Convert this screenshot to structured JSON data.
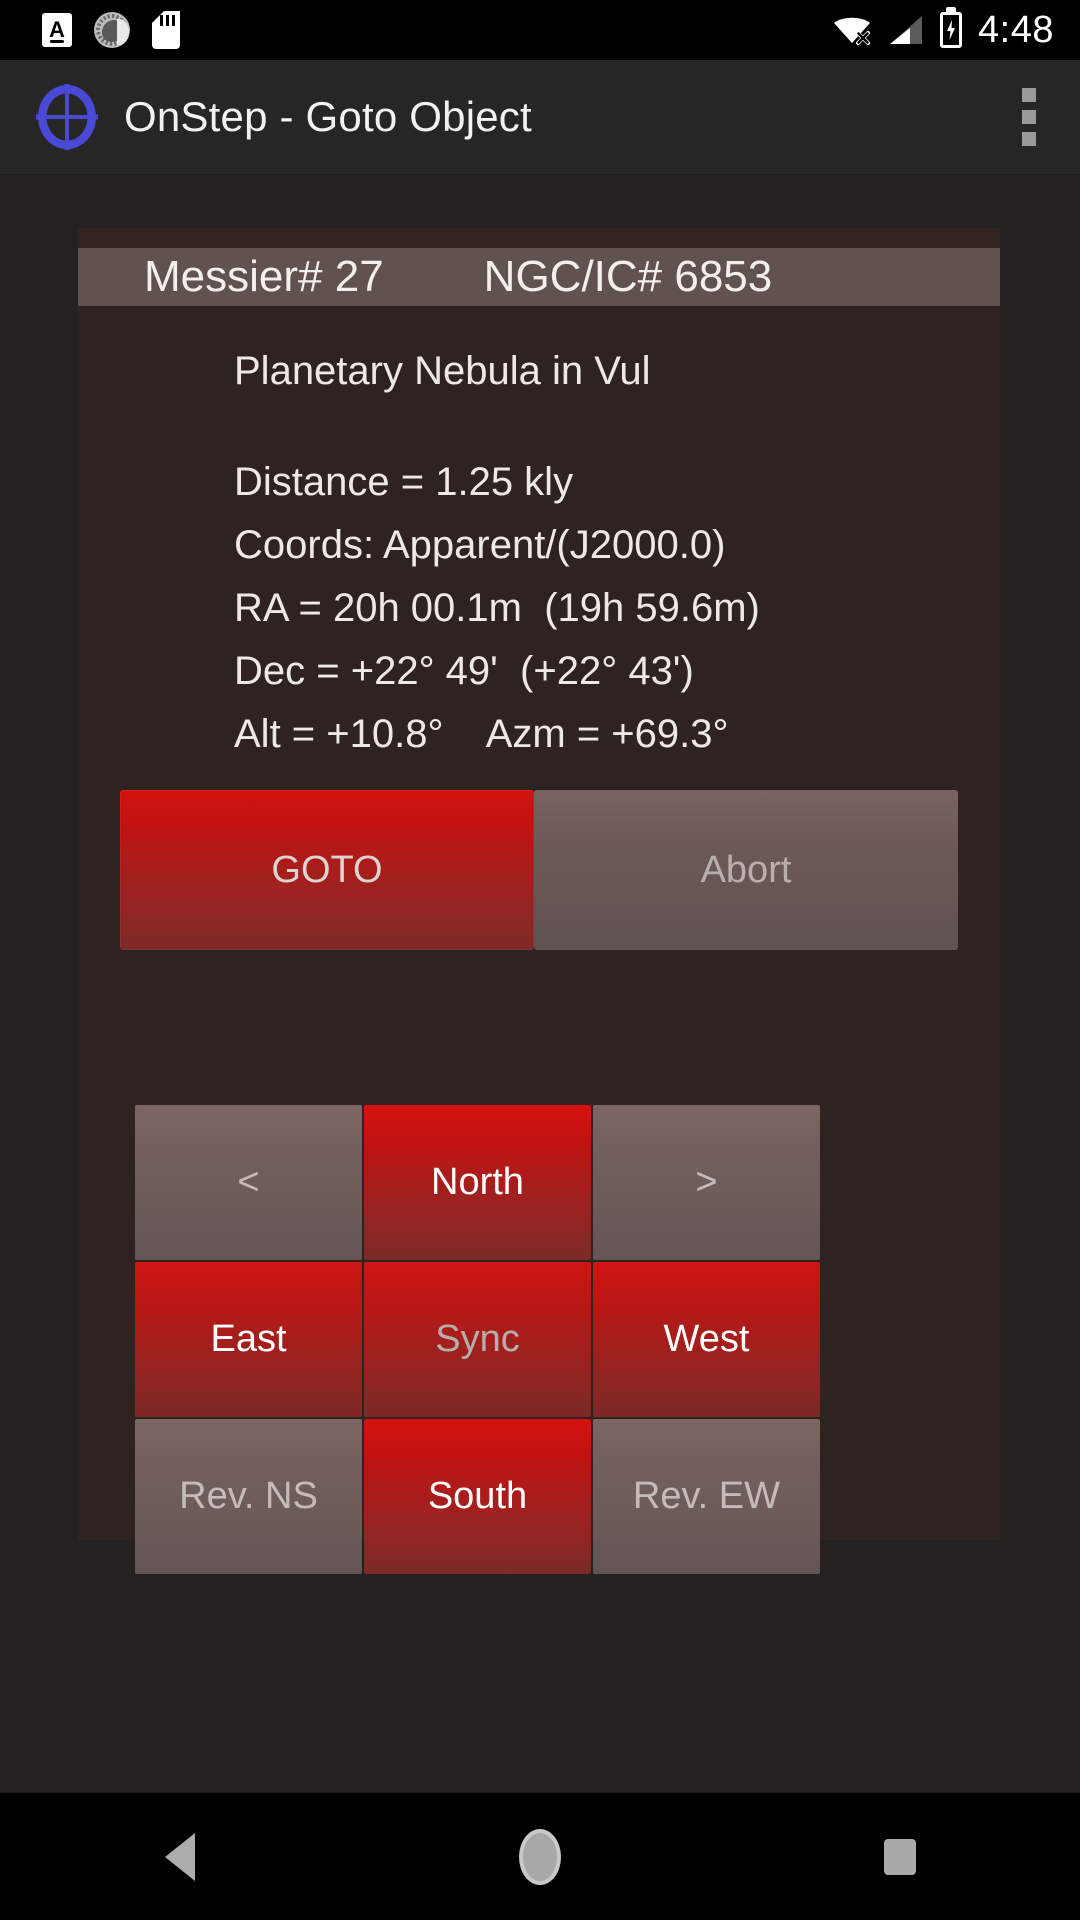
{
  "status_bar": {
    "icons_left": [
      "keyboard-icon",
      "sync-spinner-icon",
      "sd-card-icon"
    ],
    "icons_right": [
      "wifi-off-icon",
      "cell-signal-icon",
      "battery-charging-icon"
    ],
    "keyboard_glyph": "A",
    "time": "4:48"
  },
  "app_bar": {
    "icon": "onstep-gear-crosshair-icon",
    "title": "OnStep - Goto Object",
    "overflow": "overflow-menu-icon"
  },
  "object": {
    "messier": "Messier# 27",
    "ngc_ic": "NGC/IC# 6853",
    "type_line": "Planetary Nebula in Vul",
    "distance": "Distance = 1.25 kly",
    "coords_label": "Coords: Apparent/(J2000.0)",
    "ra": "RA = 20h 00.1m  (19h 59.6m)",
    "dec": "Dec = +22° 49'  (+22° 43')",
    "altazm": "Alt = +10.8°    Azm = +69.3°"
  },
  "actions": {
    "goto_label": "GOTO",
    "abort_label": "Abort"
  },
  "dpad": {
    "rows": [
      [
        {
          "label": "<",
          "style": "gray"
        },
        {
          "label": "North",
          "style": "red-bright"
        },
        {
          "label": ">",
          "style": "gray"
        }
      ],
      [
        {
          "label": "East",
          "style": "red-white"
        },
        {
          "label": "Sync",
          "style": "red-dim"
        },
        {
          "label": "West",
          "style": "red-white"
        }
      ],
      [
        {
          "label": "Rev. NS",
          "style": "gray"
        },
        {
          "label": "South",
          "style": "red-bright"
        },
        {
          "label": "Rev. EW",
          "style": "gray"
        }
      ]
    ]
  },
  "nav_bar": {
    "back": "back-nav-icon",
    "home": "home-nav-icon",
    "recents": "recents-nav-icon"
  },
  "colors": {
    "page_background": "#242221",
    "panel_background": "#2e2321",
    "header_bar": "#60534f",
    "accent_red": "#c01311",
    "muted_button": "#6f5b58",
    "app_icon_blue": "#4a49d6",
    "text_primary": "#efe9e6"
  }
}
